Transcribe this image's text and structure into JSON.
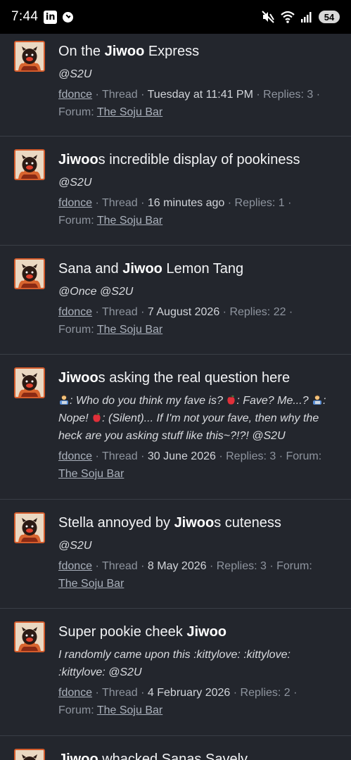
{
  "status_bar": {
    "time": "7:44",
    "battery": "54"
  },
  "threads": [
    {
      "title_parts": [
        {
          "t": "On the ",
          "b": false
        },
        {
          "t": "Jiwoo",
          "b": true
        },
        {
          "t": " Express",
          "b": false
        }
      ],
      "snippet": "@S2U",
      "author": "fdonce",
      "type": "Thread",
      "date": "Tuesday at 11:41 PM",
      "replies": "Replies: 3",
      "forum_label": "Forum:",
      "forum": "The Soju Bar"
    },
    {
      "title_parts": [
        {
          "t": "Jiwoo",
          "b": true
        },
        {
          "t": "s incredible display of pookiness",
          "b": false
        }
      ],
      "snippet": "@S2U",
      "author": "fdonce",
      "type": "Thread",
      "date": "16 minutes ago",
      "replies": "Replies: 1",
      "forum_label": "Forum:",
      "forum": "The Soju Bar"
    },
    {
      "title_parts": [
        {
          "t": "Sana and ",
          "b": false
        },
        {
          "t": "Jiwoo",
          "b": true
        },
        {
          "t": " Lemon Tang",
          "b": false
        }
      ],
      "snippet": "@Once @S2U",
      "author": "fdonce",
      "type": "Thread",
      "date": "7 August 2026",
      "replies": "Replies: 22",
      "forum_label": "Forum:",
      "forum": "The Soju Bar"
    },
    {
      "title_parts": [
        {
          "t": "Jiwoo",
          "b": true
        },
        {
          "t": "s asking the real question here",
          "b": false
        }
      ],
      "snippet_lines": [
        [
          "dev",
          ": Who do you think my fave is? ",
          "apple",
          ": Fave? Me...? ",
          "dev",
          ":"
        ],
        [
          "Nope! ",
          "apple",
          ": (Silent)... If I'm not your fave, then why the"
        ],
        [
          "heck are you asking stuff like this~?!?! @S2U"
        ]
      ],
      "author": "fdonce",
      "type": "Thread",
      "date": "30 June 2026",
      "replies": "Replies: 3",
      "forum_label": "Forum:",
      "forum": "The Soju Bar"
    },
    {
      "title_parts": [
        {
          "t": "Stella annoyed by ",
          "b": false
        },
        {
          "t": "Jiwoo",
          "b": true
        },
        {
          "t": "s cuteness",
          "b": false
        }
      ],
      "snippet": "@S2U",
      "author": "fdonce",
      "type": "Thread",
      "date": "8 May 2026",
      "replies": "Replies: 3",
      "forum_label": "Forum:",
      "forum": "The Soju Bar"
    },
    {
      "title_parts": [
        {
          "t": "Super pookie cheek ",
          "b": false
        },
        {
          "t": "Jiwoo",
          "b": true
        }
      ],
      "snippet_lines": [
        [
          "I randomly came upon this :kittylove: :kittylove:"
        ],
        [
          ":kittylove: @S2U"
        ]
      ],
      "author": "fdonce",
      "type": "Thread",
      "date": "4 February 2026",
      "replies": "Replies: 2",
      "forum_label": "Forum:",
      "forum": "The Soju Bar"
    },
    {
      "title_parts": [
        {
          "t": "Jiwoo",
          "b": true
        },
        {
          "t": " whacked Sanas Savely",
          "b": false
        }
      ],
      "partial": true
    }
  ]
}
